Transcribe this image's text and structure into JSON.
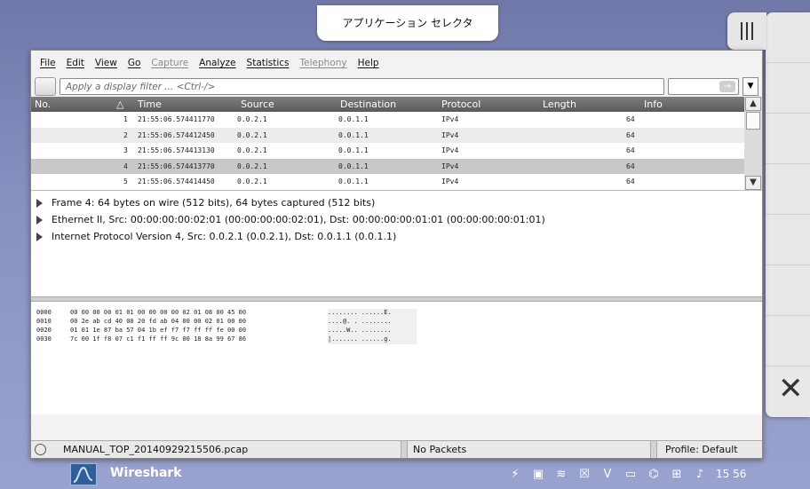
{
  "app_selector": {
    "title": "アプリケーション セレクタ"
  },
  "menubar": {
    "items": [
      {
        "label": "File",
        "enabled": true
      },
      {
        "label": "Edit",
        "enabled": true
      },
      {
        "label": "View",
        "enabled": true
      },
      {
        "label": "Go",
        "enabled": true
      },
      {
        "label": "Capture",
        "enabled": false
      },
      {
        "label": "Analyze",
        "enabled": true
      },
      {
        "label": "Statistics",
        "enabled": true
      },
      {
        "label": "Telephony",
        "enabled": false
      },
      {
        "label": "Help",
        "enabled": true
      }
    ]
  },
  "filter": {
    "placeholder": "Apply a display filter ... <Ctrl-/>",
    "apply_arrow": "→"
  },
  "packet_list": {
    "columns": [
      "No.",
      "Time",
      "Source",
      "Destination",
      "Protocol",
      "Length",
      "Info"
    ],
    "sort_indicator": "△",
    "rows": [
      {
        "no": "1",
        "time": "21:55:06.574411770",
        "source": "0.0.2.1",
        "destination": "0.0.1.1",
        "protocol": "IPv4",
        "length": "64",
        "info": ""
      },
      {
        "no": "2",
        "time": "21:55:06.574412450",
        "source": "0.0.2.1",
        "destination": "0.0.1.1",
        "protocol": "IPv4",
        "length": "64",
        "info": ""
      },
      {
        "no": "3",
        "time": "21:55:06.574413130",
        "source": "0.0.2.1",
        "destination": "0.0.1.1",
        "protocol": "IPv4",
        "length": "64",
        "info": ""
      },
      {
        "no": "4",
        "time": "21:55:06.574413770",
        "source": "0.0.2.1",
        "destination": "0.0.1.1",
        "protocol": "IPv4",
        "length": "64",
        "info": ""
      },
      {
        "no": "5",
        "time": "21:55:06.574414450",
        "source": "0.0.2.1",
        "destination": "0.0.1.1",
        "protocol": "IPv4",
        "length": "64",
        "info": ""
      }
    ],
    "selected_row": 4
  },
  "details": {
    "items": [
      "Frame 4: 64 bytes on wire (512 bits), 64 bytes captured (512 bits)",
      "Ethernet II, Src: 00:00:00:00:02:01 (00:00:00:00:02:01), Dst: 00:00:00:00:01:01 (00:00:00:00:01:01)",
      "Internet Protocol Version 4, Src: 0.0.2.1 (0.0.2.1), Dst: 0.0.1.1 (0.0.1.1)"
    ]
  },
  "bytes": {
    "lines": [
      {
        "offset": "0000",
        "hex": "00 00 00 00 01 01 00 00  00 00 02 01 08 00 45 00",
        "ascii": "........ ......E."
      },
      {
        "offset": "0010",
        "hex": "00 2e ab cd 40 00 20 fd  ab 04 00 00 02 01 00 00",
        "ascii": "....@. . ........"
      },
      {
        "offset": "0020",
        "hex": "01 01 1e 87 ba 57 04 1b  ef f7 f7 ff ff fe 00 00",
        "ascii": ".....W.. ........"
      },
      {
        "offset": "0030",
        "hex": "7c 00 1f f8 07 c1 f1 ff  ff 9c 00 18 8a 99 67 86",
        "ascii": "|....... ......g."
      }
    ]
  },
  "statusbar": {
    "file": "MANUAL_TOP_20140929215506.pcap",
    "packets": "No Packets",
    "profile": "Profile: Default"
  },
  "taskbar": {
    "app_name": "Wireshark",
    "clock": "15 56",
    "tray_icons": [
      "power-icon",
      "display-icon",
      "wifi-icon",
      "network-disabled-icon",
      "v-icon",
      "terminal-icon",
      "satellite-icon",
      "network-icon",
      "volume-icon"
    ]
  }
}
